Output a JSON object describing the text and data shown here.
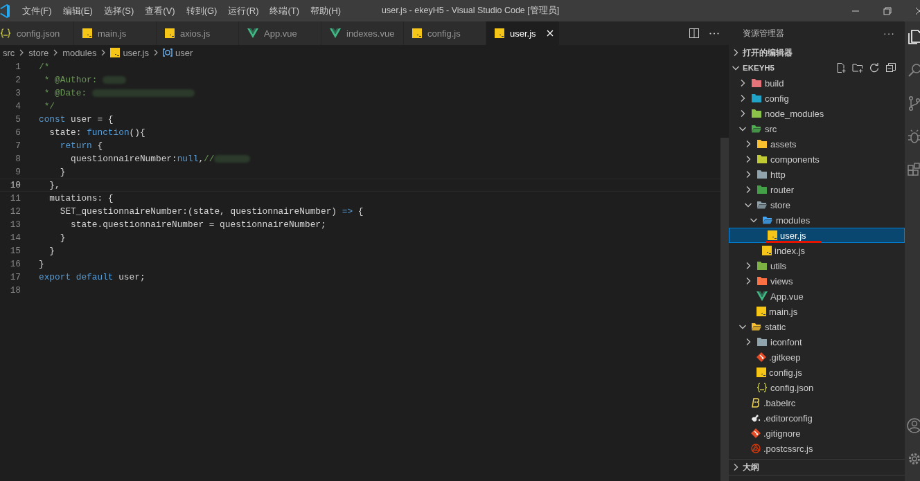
{
  "window": {
    "title": "user.js - ekeyH5 - Visual Studio Code [管理员]"
  },
  "menu": [
    "文件(F)",
    "编辑(E)",
    "选择(S)",
    "查看(V)",
    "转到(G)",
    "运行(R)",
    "终端(T)",
    "帮助(H)"
  ],
  "tabs": [
    {
      "label": "config.json",
      "kind": "json",
      "selected": false
    },
    {
      "label": "main.js",
      "kind": "js",
      "selected": false
    },
    {
      "label": "axios.js",
      "kind": "js",
      "selected": false
    },
    {
      "label": "App.vue",
      "kind": "vue",
      "selected": false
    },
    {
      "label": "indexes.vue",
      "kind": "vue",
      "selected": false
    },
    {
      "label": "config.js",
      "kind": "js",
      "selected": false
    },
    {
      "label": "user.js",
      "kind": "js",
      "selected": true
    }
  ],
  "breadcrumb": [
    {
      "label": "src"
    },
    {
      "label": "store"
    },
    {
      "label": "modules"
    },
    {
      "label": "user.js",
      "kind": "js"
    },
    {
      "label": "user",
      "kind": "symbol"
    }
  ],
  "code": [
    {
      "number": "1",
      "current": false,
      "tokens": [
        {
          "kind": "comment",
          "t": "/*"
        }
      ]
    },
    {
      "number": "2",
      "current": false,
      "tokens": [
        {
          "kind": "comment",
          "t": " * @Author: "
        },
        {
          "kind": "blur-s"
        }
      ]
    },
    {
      "number": "3",
      "current": false,
      "tokens": [
        {
          "kind": "comment",
          "t": " * @Date: "
        },
        {
          "kind": "blur-l"
        }
      ]
    },
    {
      "number": "4",
      "current": false,
      "tokens": [
        {
          "kind": "comment",
          "t": " */"
        }
      ]
    },
    {
      "number": "5",
      "current": false,
      "tokens": [
        {
          "kind": "keyword",
          "t": "const"
        },
        {
          "kind": "plain",
          "t": " user = {"
        }
      ]
    },
    {
      "number": "6",
      "current": false,
      "tokens": [
        {
          "kind": "plain",
          "t": "  state: "
        },
        {
          "kind": "keyword",
          "t": "function"
        },
        {
          "kind": "plain",
          "t": "(){"
        }
      ]
    },
    {
      "number": "7",
      "current": false,
      "tokens": [
        {
          "kind": "keyword",
          "t": "    return"
        },
        {
          "kind": "plain",
          "t": " {"
        }
      ]
    },
    {
      "number": "8",
      "current": false,
      "tokens": [
        {
          "kind": "plain",
          "t": "      questionnaireNumber:"
        },
        {
          "kind": "keyword",
          "t": "null"
        },
        {
          "kind": "plain",
          "t": ","
        },
        {
          "kind": "comment",
          "t": "//"
        },
        {
          "kind": "blur-m"
        }
      ]
    },
    {
      "number": "9",
      "current": false,
      "tokens": [
        {
          "kind": "plain",
          "t": "    }"
        }
      ]
    },
    {
      "number": "10",
      "current": true,
      "tokens": [
        {
          "kind": "plain",
          "t": "  },"
        }
      ]
    },
    {
      "number": "11",
      "current": false,
      "tokens": [
        {
          "kind": "plain",
          "t": "  mutations: {"
        }
      ]
    },
    {
      "number": "12",
      "current": false,
      "tokens": [
        {
          "kind": "plain",
          "t": "    SET_questionnaireNumber:(state, questionnaireNumber) "
        },
        {
          "kind": "keyword",
          "t": "=>"
        },
        {
          "kind": "plain",
          "t": " {"
        }
      ]
    },
    {
      "number": "13",
      "current": false,
      "tokens": [
        {
          "kind": "plain",
          "t": "      state.questionnaireNumber = questionnaireNumber;"
        }
      ]
    },
    {
      "number": "14",
      "current": false,
      "tokens": [
        {
          "kind": "plain",
          "t": "    }"
        }
      ]
    },
    {
      "number": "15",
      "current": false,
      "tokens": [
        {
          "kind": "plain",
          "t": "  }"
        }
      ]
    },
    {
      "number": "16",
      "current": false,
      "tokens": [
        {
          "kind": "plain",
          "t": "}"
        }
      ]
    },
    {
      "number": "17",
      "current": false,
      "tokens": [
        {
          "kind": "keyword",
          "t": "export default"
        },
        {
          "kind": "plain",
          "t": " user;"
        }
      ]
    },
    {
      "number": "18",
      "current": false
    }
  ],
  "sidebar": {
    "title": "资源管理器",
    "more": "···",
    "sections_top": [
      {
        "label": "打开的编辑器",
        "expanded": false
      }
    ],
    "project": {
      "label": "EKEYH5",
      "expanded": true
    },
    "tree": [
      {
        "name": "build",
        "kind": "folder",
        "color": "#e5737a",
        "expanded": false,
        "selected": false
      },
      {
        "name": "config",
        "kind": "folder",
        "color": "#1fa3c7",
        "expanded": false,
        "selected": false
      },
      {
        "name": "node_modules",
        "kind": "folder",
        "color": "#8bc34a",
        "expanded": false,
        "selected": false
      },
      {
        "name": "src",
        "kind": "folder",
        "color": "#4caf50",
        "expanded": true,
        "selected": false,
        "children": [
          {
            "name": "assets",
            "kind": "folder",
            "color": "#fbc02d",
            "expanded": false,
            "selected": false
          },
          {
            "name": "components",
            "kind": "folder",
            "color": "#c0ca33",
            "expanded": false,
            "selected": false
          },
          {
            "name": "http",
            "kind": "folder",
            "color": "#90a4ae",
            "expanded": false,
            "selected": false
          },
          {
            "name": "router",
            "kind": "folder",
            "color": "#43a047",
            "expanded": false,
            "selected": false
          },
          {
            "name": "store",
            "kind": "folder",
            "color": "#90a4ae",
            "expanded": true,
            "selected": false,
            "children": [
              {
                "name": "modules",
                "kind": "folder",
                "color": "#42a5f5",
                "expanded": true,
                "selected": false,
                "children": [
                  {
                    "name": "user.js",
                    "kind": "js",
                    "selected": true,
                    "underlined": true
                  }
                ]
              },
              {
                "name": "index.js",
                "kind": "js",
                "selected": false
              }
            ]
          },
          {
            "name": "utils",
            "kind": "folder",
            "color": "#7cb342",
            "expanded": false,
            "selected": false
          },
          {
            "name": "views",
            "kind": "folder",
            "color": "#ff7043",
            "expanded": false,
            "selected": false
          },
          {
            "name": "App.vue",
            "kind": "vue",
            "selected": false
          },
          {
            "name": "main.js",
            "kind": "js",
            "selected": false
          }
        ]
      },
      {
        "name": "static",
        "kind": "folder",
        "color": "#fbc02d",
        "expanded": true,
        "selected": false,
        "children": [
          {
            "name": "iconfont",
            "kind": "folder",
            "color": "#90a4ae",
            "expanded": false,
            "selected": false
          },
          {
            "name": ".gitkeep",
            "kind": "git",
            "selected": false
          },
          {
            "name": "config.js",
            "kind": "js",
            "selected": false
          },
          {
            "name": "config.json",
            "kind": "json",
            "selected": false
          }
        ]
      },
      {
        "name": ".babelrc",
        "kind": "babel",
        "selected": false
      },
      {
        "name": ".editorconfig",
        "kind": "editorconfig",
        "selected": false
      },
      {
        "name": ".gitignore",
        "kind": "git",
        "selected": false
      },
      {
        "name": ".postcssrc.js",
        "kind": "postcss",
        "selected": false
      }
    ],
    "sections_bottom": [
      {
        "label": "大纲",
        "expanded": false
      }
    ]
  }
}
